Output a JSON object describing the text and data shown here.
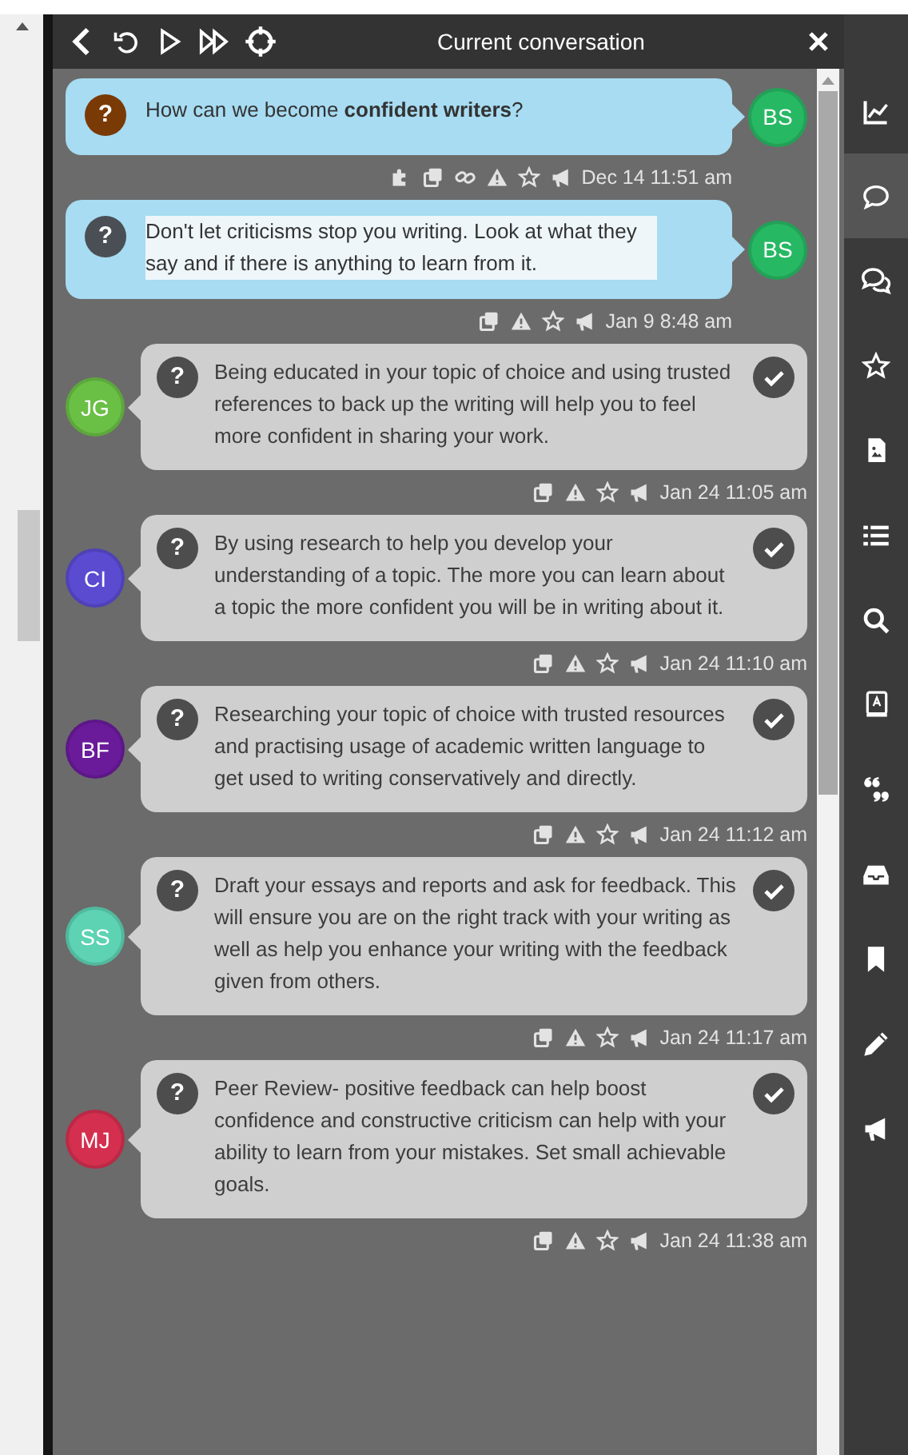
{
  "header": {
    "title": "Current conversation"
  },
  "messages": [
    {
      "kind": "own",
      "text": "How can we become **confident writers**?",
      "avatar": "BS",
      "color": "#27b864",
      "question": {
        "label": "?",
        "color": "#7a3a05"
      },
      "text_selected": false,
      "tagged": true,
      "linked": true,
      "time": "Dec 14 11:51 am"
    },
    {
      "kind": "own",
      "text": "Don't let criticisms stop you writing. Look at what they say and if there is anything to learn from it.",
      "avatar": "BS",
      "color": "#27b864",
      "question": {
        "label": "?",
        "color": "#4a4f55"
      },
      "text_selected": true,
      "tagged": false,
      "linked": false,
      "time": "Jan 9 8:48 am"
    },
    {
      "kind": "reply",
      "text": "Being educated in your topic of choice and using trusted references to back up the writing will help you to feel more confident in sharing your work.",
      "avatar": "JG",
      "color": "#6abf45",
      "question": {
        "label": "?",
        "color": "#4d4d4d"
      },
      "text_selected": false,
      "tagged": false,
      "linked": false,
      "time": "Jan 24 11:05 am"
    },
    {
      "kind": "reply",
      "text": "By using research to help you develop your understanding of a topic. The more you can learn about a topic the more confident you will be in writing about it.",
      "avatar": "CI",
      "color": "#5a4bd1",
      "question": {
        "label": "?",
        "color": "#4d4d4d"
      },
      "text_selected": false,
      "tagged": false,
      "linked": false,
      "time": "Jan 24 11:10 am"
    },
    {
      "kind": "reply",
      "text": "Researching your topic of choice with trusted resources and practising usage of academic written language to get used to writing conservatively and directly.",
      "avatar": "BF",
      "color": "#6a1b9a",
      "question": {
        "label": "?",
        "color": "#4d4d4d"
      },
      "text_selected": false,
      "tagged": false,
      "linked": false,
      "time": "Jan 24 11:12 am"
    },
    {
      "kind": "reply",
      "text": "Draft your essays and reports and ask for feedback. This will ensure you are on the right track with your writing as well as help you enhance your writing with the feedback given from others.",
      "avatar": "SS",
      "color": "#5dd3b3",
      "question": {
        "label": "?",
        "color": "#4d4d4d"
      },
      "text_selected": false,
      "tagged": false,
      "linked": false,
      "time": "Jan 24 11:17 am"
    },
    {
      "kind": "reply",
      "text": "Peer Review- positive feedback can help boost confidence and constructive criticism can help with your ability to learn from your mistakes. Set small achievable goals.",
      "avatar": "MJ",
      "color": "#d42f4f",
      "question": {
        "label": "?",
        "color": "#4d4d4d"
      },
      "text_selected": false,
      "tagged": false,
      "linked": false,
      "time": "Jan 24 11:38 am"
    }
  ],
  "sidebar": {
    "items": [
      {
        "kind": "chart",
        "selected": false
      },
      {
        "kind": "chat",
        "selected": true
      },
      {
        "kind": "chats",
        "selected": false
      },
      {
        "kind": "star",
        "selected": false
      },
      {
        "kind": "file",
        "selected": false
      },
      {
        "kind": "list",
        "selected": false
      },
      {
        "kind": "search",
        "selected": false
      },
      {
        "kind": "book",
        "selected": false
      },
      {
        "kind": "quote",
        "selected": false
      },
      {
        "kind": "inbox",
        "selected": false
      },
      {
        "kind": "bookmark",
        "selected": false
      },
      {
        "kind": "pencil",
        "selected": false
      },
      {
        "kind": "megaphone",
        "selected": false
      }
    ]
  }
}
